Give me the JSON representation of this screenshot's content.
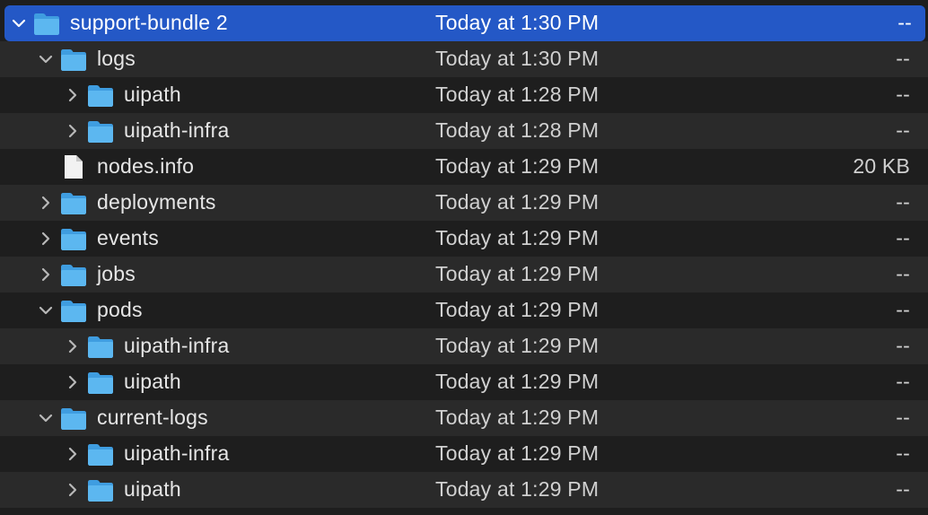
{
  "colors": {
    "background": "#1e1e1e",
    "row_alt": "#2a2a2a",
    "selection": "#2458c6",
    "folder_blue": "#5cb7f0",
    "text": "#e6e6e6"
  },
  "rows": [
    {
      "name": "support-bundle 2",
      "date": "Today at 1:30 PM",
      "size": "--",
      "icon": "folder-icon",
      "disclosure": "expanded",
      "level": 0,
      "selected": true
    },
    {
      "name": "logs",
      "date": "Today at 1:30 PM",
      "size": "--",
      "icon": "folder-icon",
      "disclosure": "expanded",
      "level": 1
    },
    {
      "name": "uipath",
      "date": "Today at 1:28 PM",
      "size": "--",
      "icon": "folder-icon",
      "disclosure": "collapsed",
      "level": 2
    },
    {
      "name": "uipath-infra",
      "date": "Today at 1:28 PM",
      "size": "--",
      "icon": "folder-icon",
      "disclosure": "collapsed",
      "level": 2
    },
    {
      "name": "nodes.info",
      "date": "Today at 1:29 PM",
      "size": "20 KB",
      "icon": "document-icon",
      "disclosure": "none",
      "level": 1
    },
    {
      "name": "deployments",
      "date": "Today at 1:29 PM",
      "size": "--",
      "icon": "folder-icon",
      "disclosure": "collapsed",
      "level": 1
    },
    {
      "name": "events",
      "date": "Today at 1:29 PM",
      "size": "--",
      "icon": "folder-icon",
      "disclosure": "collapsed",
      "level": 1
    },
    {
      "name": "jobs",
      "date": "Today at 1:29 PM",
      "size": "--",
      "icon": "folder-icon",
      "disclosure": "collapsed",
      "level": 1
    },
    {
      "name": "pods",
      "date": "Today at 1:29 PM",
      "size": "--",
      "icon": "folder-icon",
      "disclosure": "expanded",
      "level": 1
    },
    {
      "name": "uipath-infra",
      "date": "Today at 1:29 PM",
      "size": "--",
      "icon": "folder-icon",
      "disclosure": "collapsed",
      "level": 2
    },
    {
      "name": "uipath",
      "date": "Today at 1:29 PM",
      "size": "--",
      "icon": "folder-icon",
      "disclosure": "collapsed",
      "level": 2
    },
    {
      "name": "current-logs",
      "date": "Today at 1:29 PM",
      "size": "--",
      "icon": "folder-icon",
      "disclosure": "expanded",
      "level": 1
    },
    {
      "name": "uipath-infra",
      "date": "Today at 1:29 PM",
      "size": "--",
      "icon": "folder-icon",
      "disclosure": "collapsed",
      "level": 2
    },
    {
      "name": "uipath",
      "date": "Today at 1:29 PM",
      "size": "--",
      "icon": "folder-icon",
      "disclosure": "collapsed",
      "level": 2
    }
  ]
}
